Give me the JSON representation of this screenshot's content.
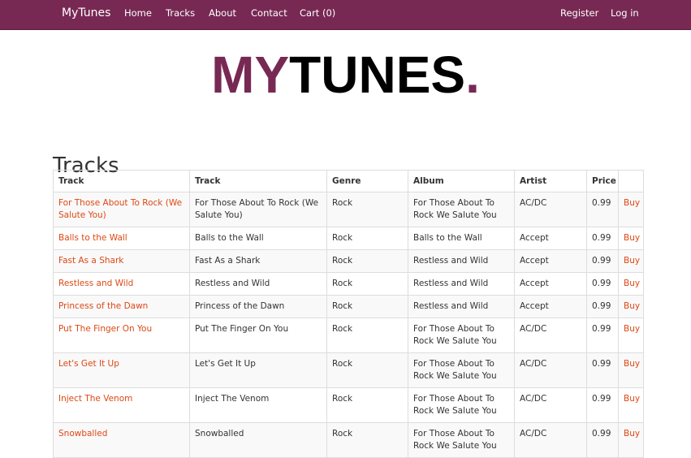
{
  "nav": {
    "brand": "MyTunes",
    "left": [
      "Home",
      "Tracks",
      "About",
      "Contact",
      "Cart (0)"
    ],
    "right": [
      "Register",
      "Log in"
    ]
  },
  "logo": {
    "part1": "MY",
    "part2": "TUNES",
    "part3": "."
  },
  "page": {
    "title": "Tracks"
  },
  "table": {
    "headers": [
      "Track",
      "Track",
      "Genre",
      "Album",
      "Artist",
      "Price",
      ""
    ],
    "buy_label": "Buy",
    "rows": [
      {
        "link": "For Those About To Rock (We Salute You)",
        "track": "For Those About To Rock (We Salute You)",
        "genre": "Rock",
        "album": "For Those About To Rock We Salute You",
        "artist": "AC/DC",
        "price": "0.99"
      },
      {
        "link": "Balls to the Wall",
        "track": "Balls to the Wall",
        "genre": "Rock",
        "album": "Balls to the Wall",
        "artist": "Accept",
        "price": "0.99"
      },
      {
        "link": "Fast As a Shark",
        "track": "Fast As a Shark",
        "genre": "Rock",
        "album": "Restless and Wild",
        "artist": "Accept",
        "price": "0.99"
      },
      {
        "link": "Restless and Wild",
        "track": "Restless and Wild",
        "genre": "Rock",
        "album": "Restless and Wild",
        "artist": "Accept",
        "price": "0.99"
      },
      {
        "link": "Princess of the Dawn",
        "track": "Princess of the Dawn",
        "genre": "Rock",
        "album": "Restless and Wild",
        "artist": "Accept",
        "price": "0.99"
      },
      {
        "link": "Put The Finger On You",
        "track": "Put The Finger On You",
        "genre": "Rock",
        "album": "For Those About To Rock We Salute You",
        "artist": "AC/DC",
        "price": "0.99"
      },
      {
        "link": "Let's Get It Up",
        "track": "Let's Get It Up",
        "genre": "Rock",
        "album": "For Those About To Rock We Salute You",
        "artist": "AC/DC",
        "price": "0.99"
      },
      {
        "link": "Inject The Venom",
        "track": "Inject The Venom",
        "genre": "Rock",
        "album": "For Those About To Rock We Salute You",
        "artist": "AC/DC",
        "price": "0.99"
      },
      {
        "link": "Snowballed",
        "track": "Snowballed",
        "genre": "Rock",
        "album": "For Those About To Rock We Salute You",
        "artist": "AC/DC",
        "price": "0.99"
      }
    ]
  }
}
